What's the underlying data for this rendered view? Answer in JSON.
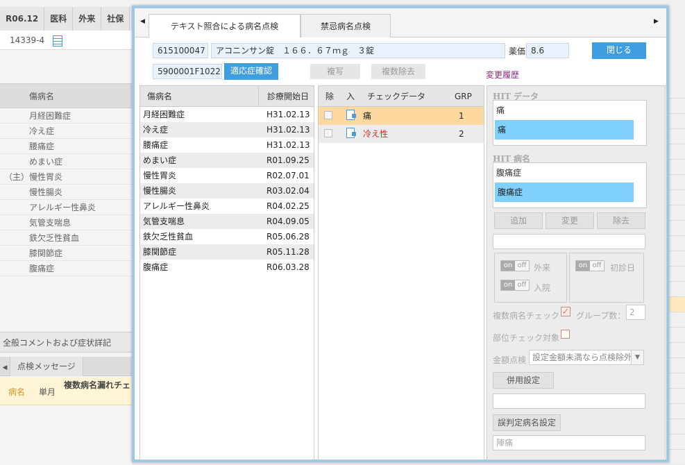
{
  "background": {
    "tabs": [
      "R06.12",
      "医科",
      "外来",
      "社保"
    ],
    "patient_id": "14339-4",
    "disease_header": "傷病名",
    "diseases": [
      {
        "mark": "",
        "name": "月経困難症"
      },
      {
        "mark": "",
        "name": "冷え症"
      },
      {
        "mark": "",
        "name": "腰痛症"
      },
      {
        "mark": "",
        "name": "めまい症"
      },
      {
        "mark": "（主）",
        "name": "慢性胃炎"
      },
      {
        "mark": "",
        "name": "慢性腸炎"
      },
      {
        "mark": "",
        "name": "アレルギー性鼻炎"
      },
      {
        "mark": "",
        "name": "気管支喘息"
      },
      {
        "mark": "",
        "name": "鉄欠乏性貧血"
      },
      {
        "mark": "",
        "name": "膝関節症"
      },
      {
        "mark": "",
        "name": "腹痛症"
      }
    ],
    "comment_section": "全般コメントおよび症状詳記",
    "message_tab": "点検メッセージ",
    "message": {
      "type": "病名",
      "period": "単月",
      "text": "複数病名漏れチェ りません。"
    }
  },
  "modal": {
    "tabs": [
      {
        "label": "テキスト照合による病名点検",
        "active": true
      },
      {
        "label": "禁忌病名点検",
        "active": false
      }
    ],
    "drug_code": "615100047",
    "drug_name": "アコニンサン錠　１６６．６７ｍｇ　３錠",
    "price_label": "薬価",
    "price": "8.6",
    "close_label": "閉じる",
    "yj_code": "5900001F1022",
    "confirm_label": "適応症確認",
    "copy_label": "複写",
    "multi_remove_label": "複数除去",
    "history_label": "変更履歴",
    "disease_table": {
      "headers": [
        "傷病名",
        "診療開始日"
      ],
      "rows": [
        {
          "name": "月経困難症",
          "date": "H31.02.13"
        },
        {
          "name": "冷え症",
          "date": "H31.02.13"
        },
        {
          "name": "腰痛症",
          "date": "H31.02.13"
        },
        {
          "name": "めまい症",
          "date": "R01.09.25"
        },
        {
          "name": "慢性胃炎",
          "date": "R02.07.01"
        },
        {
          "name": "慢性腸炎",
          "date": "R03.02.04"
        },
        {
          "name": "アレルギー性鼻炎",
          "date": "R04.02.25"
        },
        {
          "name": "気管支喘息",
          "date": "R04.09.05"
        },
        {
          "name": "鉄欠乏性貧血",
          "date": "R05.06.28"
        },
        {
          "name": "膝関節症",
          "date": "R05.11.28"
        },
        {
          "name": "腹痛症",
          "date": "R06.03.28"
        }
      ]
    },
    "check_table": {
      "headers": [
        "除",
        "入",
        "チェックデータ",
        "GRP"
      ],
      "rows": [
        {
          "data": "痛",
          "grp": "1",
          "selected": true,
          "color": "#222222"
        },
        {
          "data": "冷え性",
          "grp": "2",
          "selected": false,
          "color": "#e02020"
        }
      ]
    },
    "panel": {
      "hit_data_label": "HIT データ",
      "hit_data": [
        "痛",
        "痛"
      ],
      "hit_disease_label": "HIT 病名",
      "hit_disease": [
        "腹痛症",
        "腹痛症"
      ],
      "add_label": "追加",
      "change_label": "変更",
      "remove_label": "除去",
      "toggle_on": "on",
      "toggle_off": "off",
      "outpatient_label": "外来",
      "inpatient_label": "入院",
      "first_visit_label": "初診日",
      "multi_check_label": "複数病名チェック",
      "group_count_label": "グループ数：",
      "group_count": "2",
      "site_check_label": "部位チェック対象",
      "amount_label": "金額点検",
      "amount_select": "設定金額未満なら点検除外",
      "combo_label": "併用設定",
      "misjudge_label": "誤判定病名設定",
      "misjudge_value": "陣痛"
    }
  },
  "colors": {
    "accent": "#3f9ee0",
    "selected_row": "#fdd9a0",
    "hit_highlight": "#7fd1fb",
    "modal_border": "#9ec7e4"
  }
}
